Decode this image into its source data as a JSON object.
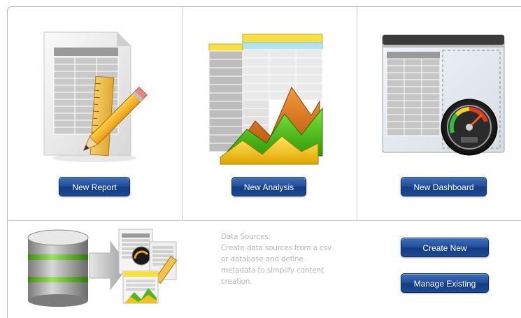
{
  "tiles": [
    {
      "button_label": "New Report",
      "image": "report-spreadsheet-ruler-pencil-icon"
    },
    {
      "button_label": "New Analysis",
      "image": "analysis-spreadsheet-area-chart-icon"
    },
    {
      "button_label": "New Dashboard",
      "image": "dashboard-gauge-icon"
    }
  ],
  "data_sources": {
    "image": "database-to-reports-icon",
    "lines": [
      "Data Sources:",
      "Create data sources from a csv",
      "or database and define",
      "metadata to simplify content",
      "creation."
    ],
    "create_label": "Create New",
    "manage_label": "Manage Existing"
  },
  "colors": {
    "button_top": "#3f6fb8",
    "button_bottom": "#143c82",
    "description_text": "#b8b8b8",
    "divider": "#cfcfcf"
  }
}
